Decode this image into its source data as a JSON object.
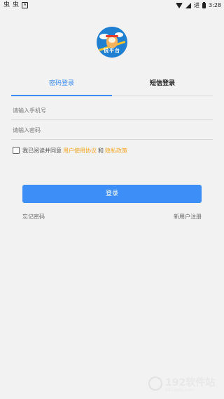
{
  "status_bar": {
    "time": "3:28",
    "signal_text": "进"
  },
  "logo": {
    "text": "锐平台"
  },
  "tabs": [
    {
      "label": "密码登录",
      "active": true
    },
    {
      "label": "短信登录",
      "active": false
    }
  ],
  "form": {
    "phone_placeholder": "请输入手机号",
    "password_placeholder": "请输入密码",
    "agree_prefix": "我已阅读并同意",
    "agreement_link": "用户使用协议",
    "and_text": "和",
    "privacy_link": "隐私政策",
    "login_label": "登录",
    "forgot_label": "忘记密码",
    "register_label": "新用户注册"
  },
  "watermark": {
    "text": "192软件站",
    "sub": "192apps.com"
  },
  "colors": {
    "accent": "#3a8cf7",
    "link": "#f5a623",
    "background": "#f2f2f2"
  },
  "icons": {
    "status_left": [
      "app-icon",
      "app-icon",
      "sim-icon"
    ],
    "status_right": [
      "wifi-icon",
      "signal-icon",
      "battery-icon"
    ]
  }
}
